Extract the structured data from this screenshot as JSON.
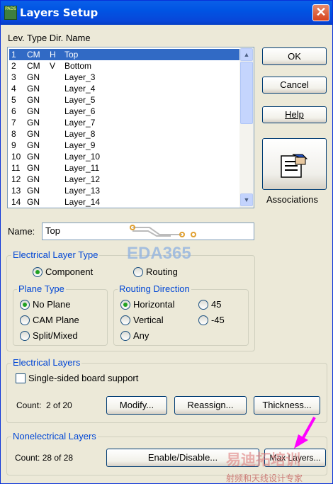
{
  "window": {
    "title": "Layers Setup",
    "app_icon": "PADS",
    "close_label": "✕"
  },
  "list": {
    "header": "Lev. Type Dir. Name",
    "rows": [
      {
        "lev": "1",
        "type": "CM",
        "dir": "H",
        "name": "Top"
      },
      {
        "lev": "2",
        "type": "CM",
        "dir": "V",
        "name": "Bottom"
      },
      {
        "lev": "3",
        "type": "GN",
        "dir": "",
        "name": "Layer_3"
      },
      {
        "lev": "4",
        "type": "GN",
        "dir": "",
        "name": "Layer_4"
      },
      {
        "lev": "5",
        "type": "GN",
        "dir": "",
        "name": "Layer_5"
      },
      {
        "lev": "6",
        "type": "GN",
        "dir": "",
        "name": "Layer_6"
      },
      {
        "lev": "7",
        "type": "GN",
        "dir": "",
        "name": "Layer_7"
      },
      {
        "lev": "8",
        "type": "GN",
        "dir": "",
        "name": "Layer_8"
      },
      {
        "lev": "9",
        "type": "GN",
        "dir": "",
        "name": "Layer_9"
      },
      {
        "lev": "10",
        "type": "GN",
        "dir": "",
        "name": "Layer_10"
      },
      {
        "lev": "11",
        "type": "GN",
        "dir": "",
        "name": "Layer_11"
      },
      {
        "lev": "12",
        "type": "GN",
        "dir": "",
        "name": "Layer_12"
      },
      {
        "lev": "13",
        "type": "GN",
        "dir": "",
        "name": "Layer_13"
      },
      {
        "lev": "14",
        "type": "GN",
        "dir": "",
        "name": "Layer_14"
      }
    ],
    "selected_index": 0
  },
  "buttons": {
    "ok": "OK",
    "cancel": "Cancel",
    "help": "Help",
    "associations": "Associations"
  },
  "name_field": {
    "label": "Name:",
    "value": "Top"
  },
  "electrical_layer_type": {
    "title": "Electrical Layer Type",
    "component": "Component",
    "routing": "Routing",
    "selected": "Component"
  },
  "plane_type": {
    "title": "Plane Type",
    "no_plane": "No Plane",
    "cam_plane": "CAM Plane",
    "split_mixed": "Split/Mixed",
    "selected": "No Plane"
  },
  "routing_direction": {
    "title": "Routing Direction",
    "horizontal": "Horizontal",
    "vertical": "Vertical",
    "any": "Any",
    "d45": "45",
    "dm45": "-45",
    "selected": "Horizontal"
  },
  "electrical_layers": {
    "title": "Electrical Layers",
    "single_sided": "Single-sided board support",
    "count": "Count:  2 of 20",
    "modify": "Modify...",
    "reassign": "Reassign...",
    "thickness": "Thickness..."
  },
  "nonelectrical_layers": {
    "title": "Nonelectrical Layers",
    "count": "Count: 28 of 28",
    "enable_disable": "Enable/Disable...",
    "max_layers": "Max Layers..."
  },
  "watermarks": {
    "eda": "EDA365",
    "bottom": "易迪拓培训",
    "sub": "射频和天线设计专家"
  },
  "colors": {
    "title_bar": "#0054E3",
    "selection": "#316AC5",
    "group_title": "#0046D5"
  }
}
